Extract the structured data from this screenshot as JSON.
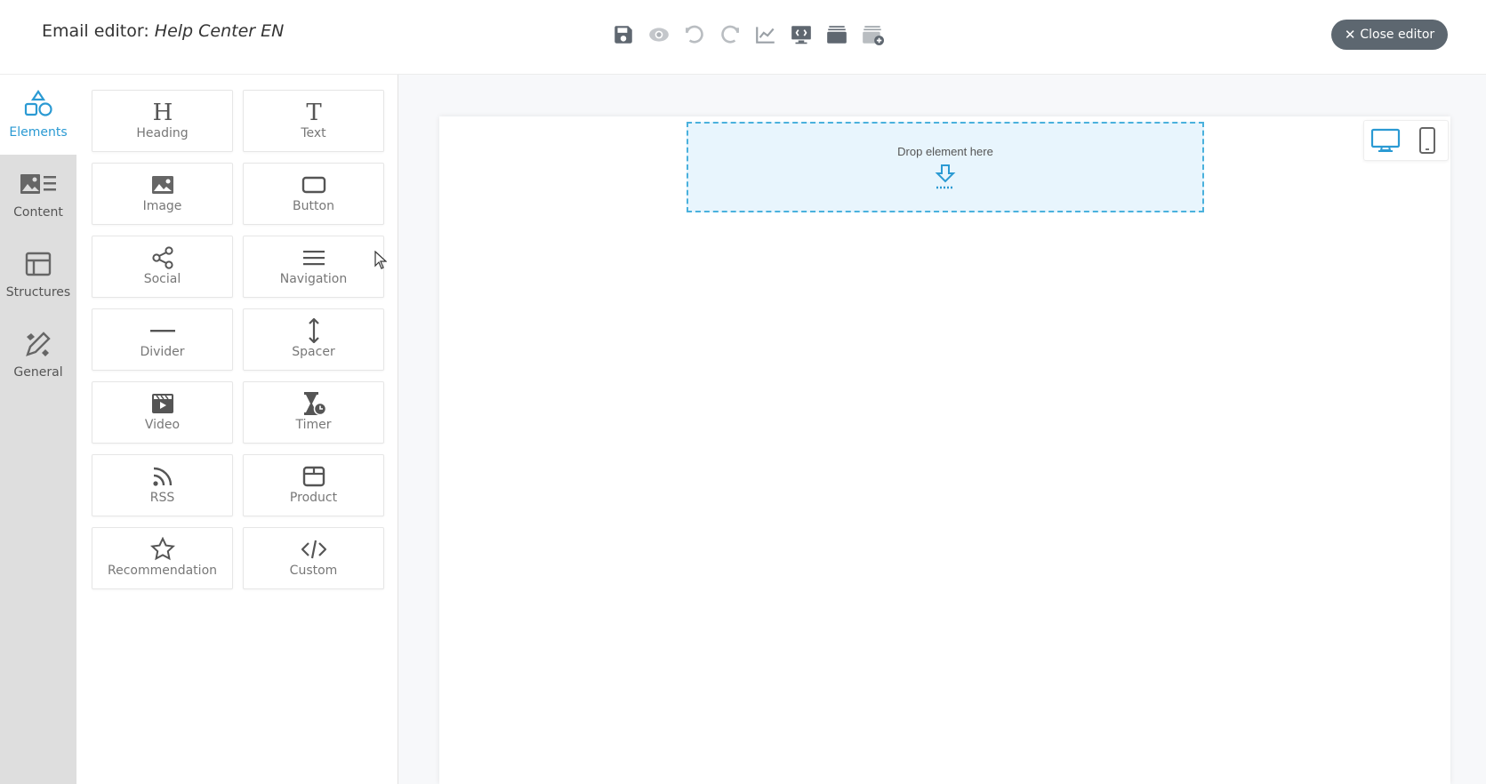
{
  "header": {
    "title_prefix": "Email editor: ",
    "title_name": "Help Center EN",
    "close_label": "Close editor",
    "toolbar": [
      {
        "name": "save-icon"
      },
      {
        "name": "preview-icon"
      },
      {
        "name": "undo-icon"
      },
      {
        "name": "redo-icon"
      },
      {
        "name": "stats-icon"
      },
      {
        "name": "code-view-icon"
      },
      {
        "name": "template-icon"
      },
      {
        "name": "add-template-icon"
      }
    ]
  },
  "sidebar": {
    "items": [
      {
        "label": "Elements",
        "icon": "shapes-icon",
        "active": true
      },
      {
        "label": "Content",
        "icon": "content-icon",
        "active": false
      },
      {
        "label": "Structures",
        "icon": "structures-icon",
        "active": false
      },
      {
        "label": "General",
        "icon": "general-icon",
        "active": false
      }
    ]
  },
  "palette": {
    "tiles": [
      {
        "label": "Heading",
        "icon": "heading-icon"
      },
      {
        "label": "Text",
        "icon": "text-icon"
      },
      {
        "label": "Image",
        "icon": "image-icon"
      },
      {
        "label": "Button",
        "icon": "button-icon"
      },
      {
        "label": "Social",
        "icon": "share-icon"
      },
      {
        "label": "Navigation",
        "icon": "menu-icon"
      },
      {
        "label": "Divider",
        "icon": "divider-icon"
      },
      {
        "label": "Spacer",
        "icon": "spacer-icon"
      },
      {
        "label": "Video",
        "icon": "video-icon"
      },
      {
        "label": "Timer",
        "icon": "timer-icon"
      },
      {
        "label": "RSS",
        "icon": "rss-icon"
      },
      {
        "label": "Product",
        "icon": "product-icon"
      },
      {
        "label": "Recommendation",
        "icon": "star-icon"
      },
      {
        "label": "Custom",
        "icon": "code-icon"
      }
    ]
  },
  "canvas": {
    "drop_label": "Drop element here"
  },
  "colors": {
    "accent": "#2b9ad3",
    "dropzone_border": "#4ab1dd",
    "dropzone_bg": "#e8f5fd",
    "close_button": "#5d6770"
  }
}
